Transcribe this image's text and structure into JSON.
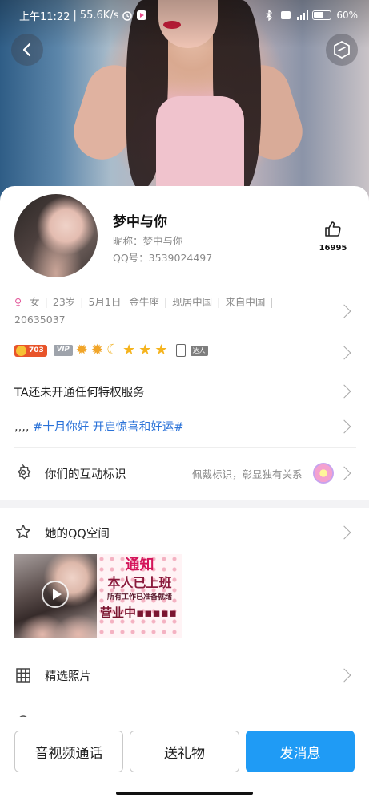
{
  "status_bar": {
    "time": "上午11:22",
    "net_speed": "55.6K/s",
    "signal_label": "4G",
    "battery": "60%"
  },
  "profile": {
    "name": "梦中与你",
    "nickname": "昵称：梦中与你",
    "qq": "QQ号：3539024497",
    "likes": "16995"
  },
  "info": {
    "gender_icon": "♀",
    "gender": "女",
    "age": "23岁",
    "birthday": "5月1日",
    "zodiac": "金牛座",
    "residence": "现居中国",
    "hometown": "来自中国",
    "extra": "20635037"
  },
  "badges": {
    "coin_value": "703",
    "vip_label": "VIP",
    "talent_label": "达人"
  },
  "privilege_text": "TA还未开通任何特权服务",
  "signature": {
    "prefix": ",,,, ",
    "tag": "#十月你好 开启惊喜和好运#"
  },
  "interaction": {
    "label": "你们的互动标识",
    "hint": "佩戴标识，彰显独有关系"
  },
  "qzone": {
    "label": "她的QQ空间",
    "notice_title": "通知",
    "notice_line1": "本人已上班",
    "notice_line2": "所有工作已准备就绪",
    "notice_line3": "营业中▪▪▪▪▪"
  },
  "photos_label": "精选照片",
  "actions": {
    "call": "音视频通话",
    "gift": "送礼物",
    "message": "发消息"
  },
  "colors": {
    "primary": "#1f9bf5",
    "tag": "#2a72d8",
    "gender": "#e35b9c"
  }
}
